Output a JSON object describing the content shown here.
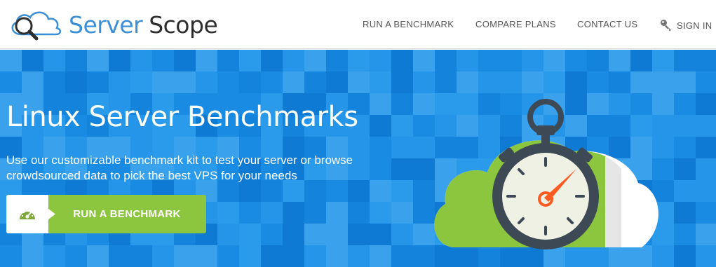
{
  "brand": {
    "word1": "Server",
    "word2": "Scope",
    "icon": "magnifier-cloud-icon",
    "colors": {
      "blue": "#3a8fd6",
      "dark": "#2e2e2e"
    }
  },
  "nav": {
    "items": [
      {
        "label": "RUN A BENCHMARK"
      },
      {
        "label": "COMPARE PLANS"
      },
      {
        "label": "CONTACT US"
      },
      {
        "label": "SIGN IN",
        "icon": "key-icon"
      }
    ]
  },
  "hero": {
    "title": "Linux Server Benchmarks",
    "subtitle_line1": "Use our customizable benchmark kit to test your server or browse",
    "subtitle_line2": "crowdsourced data to pick the best VPS for your needs",
    "cta_label": "RUN A BENCHMARK",
    "cta_icon": "speedometer-icon",
    "illustration": "stopwatch-cloud-icon",
    "colors": {
      "background": "#1a8be3",
      "cta": "#8cc63f"
    }
  }
}
